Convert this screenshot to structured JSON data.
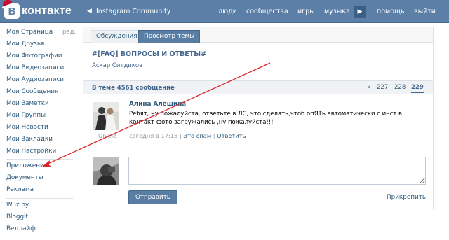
{
  "header": {
    "logo_text": "контакте",
    "logo_letter": "В",
    "back_arrow": "◀",
    "title": "Instagram Community",
    "nav": [
      "люди",
      "сообщества",
      "игры",
      "музыка",
      "помощь",
      "выйти"
    ],
    "play_glyph": "▶"
  },
  "sidebar": {
    "edit_label": "ред.",
    "items": [
      "Моя Страница",
      "Мои Друзья",
      "Мои Фотографии",
      "Мои Видеозаписи",
      "Мои Аудиозаписи",
      "Мои Сообщения",
      "Мои Заметки",
      "Мои Группы",
      "Мои Новости",
      "Мои Закладки",
      "Мои Настройки"
    ],
    "apps": [
      "Приложения",
      "Документы",
      "Реклама"
    ],
    "links": [
      "Wuz.by",
      "Bloggit",
      "Ведлайф"
    ]
  },
  "tabs": [
    "Обсуждения",
    "Просмотр темы"
  ],
  "topic": {
    "title": "#[FAQ] ВОПРОСЫ И ОТВЕТЫ#",
    "author": "Аскар Ситдиков"
  },
  "counter": {
    "text": "В теме 4561 сообщение",
    "prev": "«",
    "pages": [
      "227",
      "228"
    ],
    "current_page": "229"
  },
  "post": {
    "author": "Алина Алёшина",
    "text": "Ребят, ну пожалуйста, ответьте в ЛС, что сделать,чтоб опЯТь автоматически с инст в контакт фото загружались ,ну пожалуйста!!!",
    "time": "сегодня в 17:15",
    "sep": "|",
    "spam": "Это спам",
    "reply": "Ответить",
    "status": "Online"
  },
  "reply_form": {
    "input_value": "",
    "send_label": "Отправить",
    "attach_label": "Прикрепить"
  },
  "colors": {
    "header_bg": "#5b7fa6",
    "link": "#2b587a",
    "accent": "#597da3",
    "arrow": "#d9262a"
  }
}
